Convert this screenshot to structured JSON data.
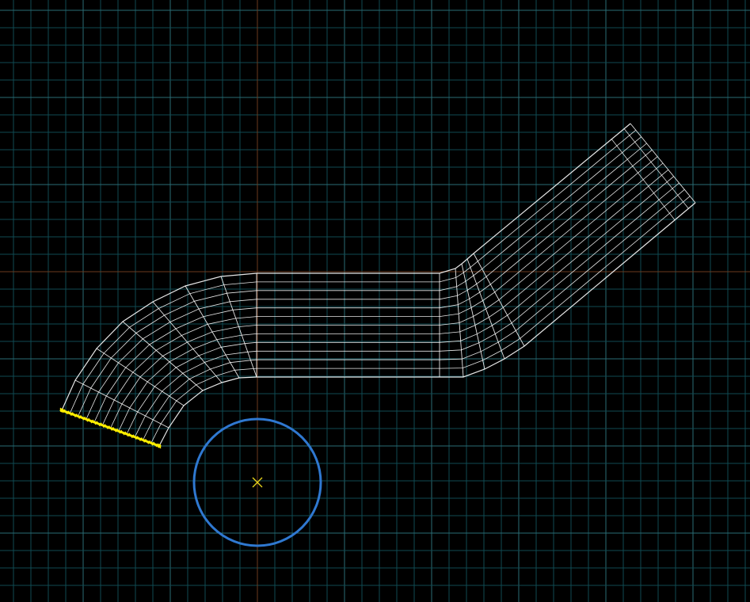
{
  "viewport": {
    "background": "#000000",
    "grid_color": "#0f4a52",
    "grid_major_color": "#2a6c74",
    "axis_x_color": "#6b3a1e",
    "axis_y_color": "#6b3a1e"
  },
  "mesh": {
    "color": "#ffffff",
    "selected_edge_color": "#ffee00",
    "vertex_marker": "yellow-vertex-marker"
  },
  "circle": {
    "color": "#2f78d0",
    "center_marker_color": "#e6d21a"
  }
}
